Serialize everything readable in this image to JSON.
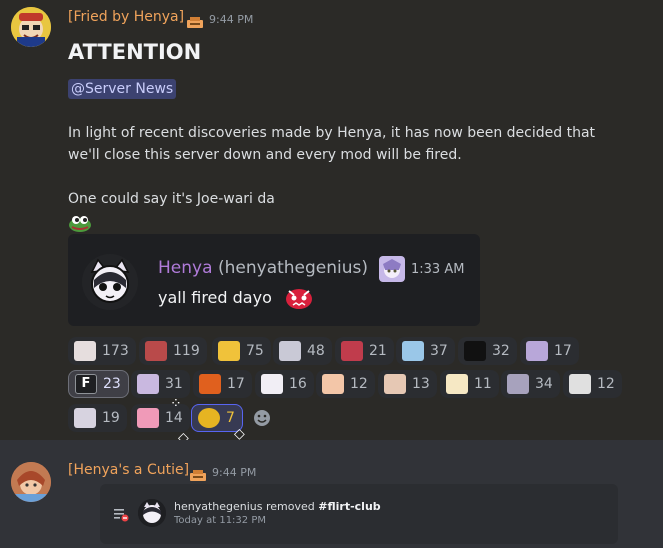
{
  "message1": {
    "author": "[Fried by Henya]",
    "time": "9:44 PM",
    "title": "ATTENTION",
    "mention": "@Server News",
    "paragraph1": "In light of recent discoveries made by Henya, it has now been decided that we'll close this server down and every mod will be fired.",
    "paragraph2": "One could say it's Joe-wari da",
    "embed": {
      "name": "Henya",
      "handle": "(henyathegenius)",
      "time": "1:33 AM",
      "text": "yall fired dayo"
    },
    "reactions": [
      {
        "count": "173",
        "color": "#e6dede"
      },
      {
        "count": "119",
        "color": "#b94a4a"
      },
      {
        "count": "75",
        "color": "#f0c23a"
      },
      {
        "count": "48",
        "color": "#c9c9d6"
      },
      {
        "count": "21",
        "color": "#c03c4c"
      },
      {
        "count": "37",
        "color": "#9ac7e8"
      },
      {
        "count": "32",
        "color": "#111111"
      },
      {
        "count": "17",
        "color": "#b8a7d9"
      },
      {
        "count": "23",
        "color": "#1e1f22",
        "selected": true,
        "icon_text": "F"
      },
      {
        "count": "31",
        "color": "#c9b8e0"
      },
      {
        "count": "17",
        "color": "#e0601e"
      },
      {
        "count": "16",
        "color": "#f1eef5"
      },
      {
        "count": "12",
        "color": "#f3c6a8"
      },
      {
        "count": "13",
        "color": "#e6c8b4"
      },
      {
        "count": "11",
        "color": "#f6e8c4"
      },
      {
        "count": "34",
        "color": "#a7a2bd"
      },
      {
        "count": "12",
        "color": "#e0e0e0"
      },
      {
        "count": "19",
        "color": "#d7d3e0"
      },
      {
        "count": "14",
        "color": "#f09ab8"
      },
      {
        "count": "7",
        "color": "#e6b422",
        "active": true
      }
    ]
  },
  "message2": {
    "author": "[Henya's a Cutie]",
    "time": "9:44 PM",
    "system": {
      "actor": "henyathegenius",
      "action": "removed",
      "channel": "#flirt-club",
      "time": "Today at 11:32 PM"
    }
  },
  "icons": [
    "tag-icon",
    "pepe-emoji",
    "smile-add-icon",
    "channel-remove-icon"
  ]
}
